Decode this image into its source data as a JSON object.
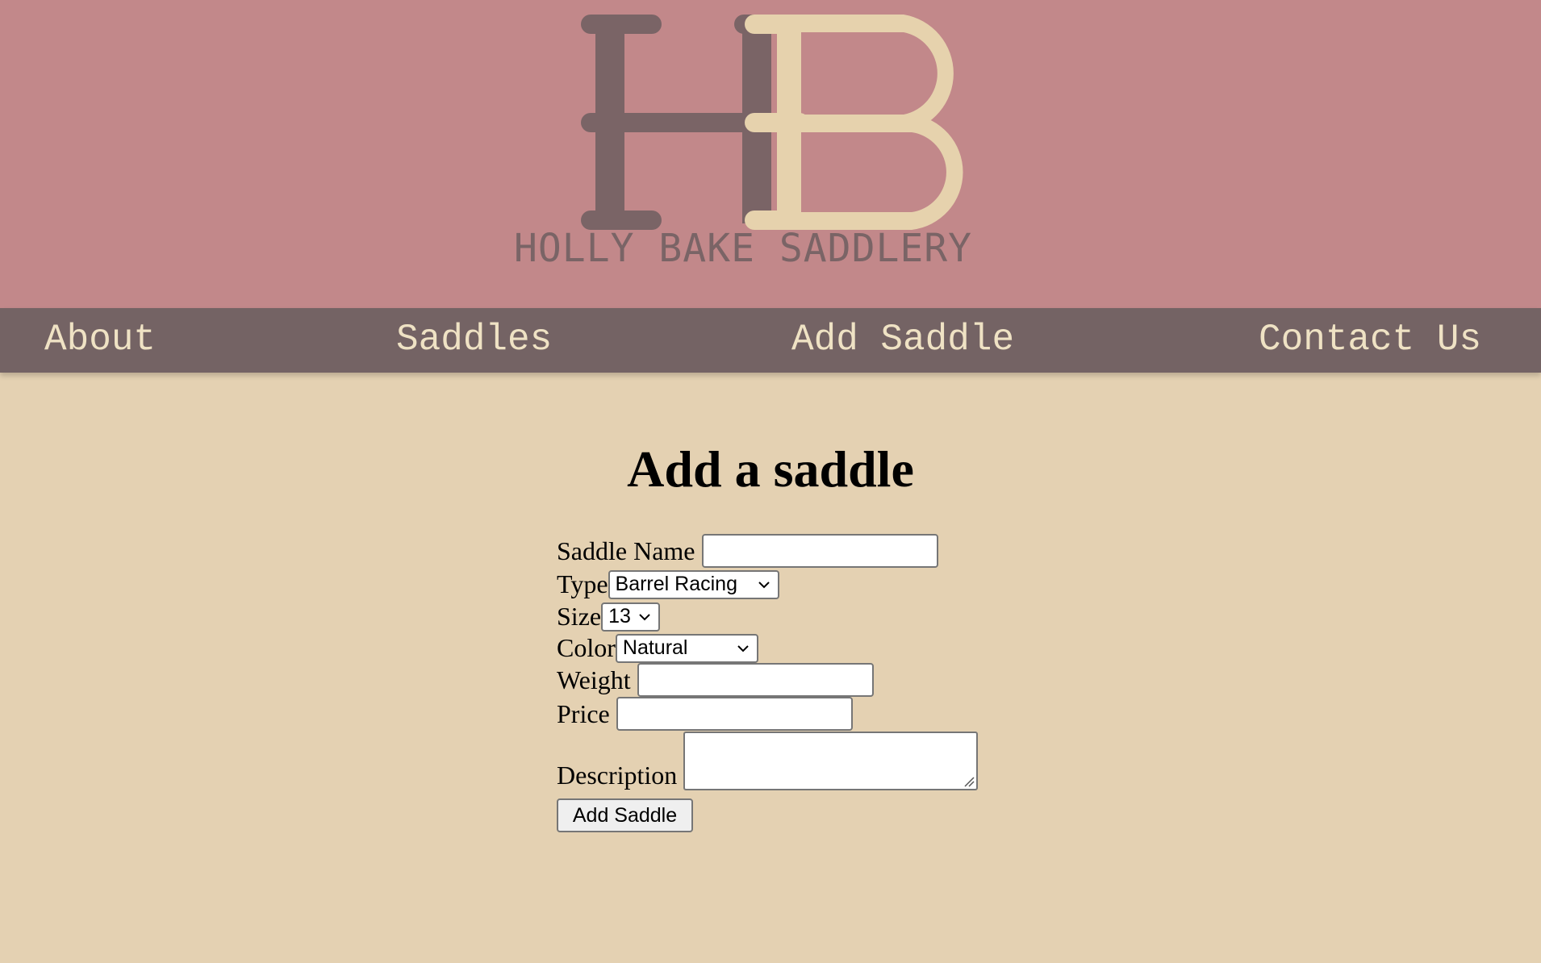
{
  "brand": {
    "name": "HOLLY BAKE SADDLERY",
    "monogram": "HB"
  },
  "nav": {
    "items": [
      {
        "label": "About"
      },
      {
        "label": "Saddles"
      },
      {
        "label": "Add Saddle"
      },
      {
        "label": "Contact Us"
      }
    ]
  },
  "page": {
    "title": "Add a saddle"
  },
  "form": {
    "saddle_name": {
      "label": "Saddle Name",
      "value": ""
    },
    "type": {
      "label": "Type",
      "selected": "Barrel Racing"
    },
    "size": {
      "label": "Size",
      "selected": "13"
    },
    "color": {
      "label": "Color",
      "selected": "Natural"
    },
    "weight": {
      "label": "Weight",
      "value": ""
    },
    "price": {
      "label": "Price",
      "value": ""
    },
    "description": {
      "label": "Description",
      "value": ""
    },
    "submit_label": "Add Saddle"
  },
  "colors": {
    "header_bg": "#c2888a",
    "nav_bg": "#746364",
    "nav_text": "#efe2c4",
    "page_bg": "#e4d1b2",
    "logo_h": "#7a6466",
    "logo_b": "#e6d2ad"
  }
}
